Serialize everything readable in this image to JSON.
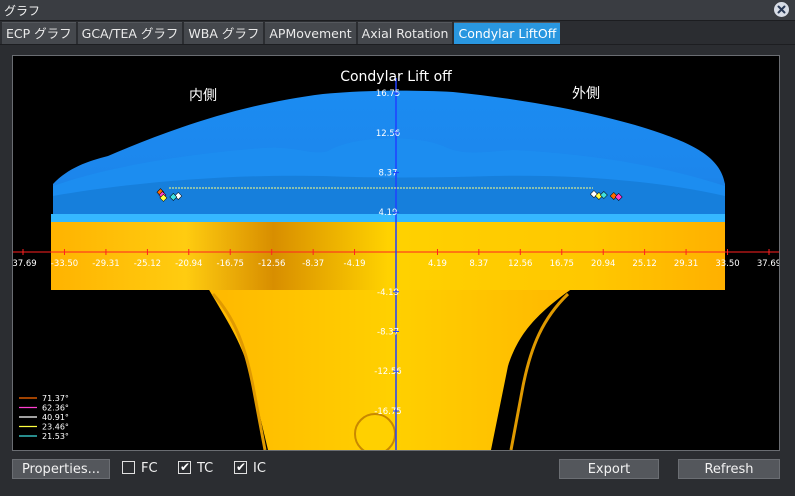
{
  "window": {
    "title": "グラフ"
  },
  "tabs": [
    {
      "label": "ECP グラフ",
      "active": false
    },
    {
      "label": "GCA/TEA グラフ",
      "active": false
    },
    {
      "label": "WBA グラフ",
      "active": false
    },
    {
      "label": "APMovement",
      "active": false
    },
    {
      "label": "Axial Rotation",
      "active": false
    },
    {
      "label": "Condylar LiftOff",
      "active": true
    }
  ],
  "chart": {
    "title": "Condylar Lift off",
    "medial_label": "内側",
    "lateral_label": "外側",
    "x_ticks": [
      "-37.69",
      "-33.50",
      "-29.31",
      "-25.12",
      "-20.94",
      "-16.75",
      "-12.56",
      "-8.37",
      "-4.19",
      "4.19",
      "8.37",
      "12.56",
      "16.75",
      "20.94",
      "25.12",
      "29.31",
      "33.50",
      "37.69"
    ],
    "y_ticks": [
      "16.75",
      "12.56",
      "8.37",
      "4.19",
      "-4.19",
      "-8.37",
      "-12.56",
      "-16.75"
    ],
    "legend": [
      {
        "label": "71.37°",
        "color": "#ff6a00"
      },
      {
        "label": "62.36°",
        "color": "#ff3fd0"
      },
      {
        "label": "40.91°",
        "color": "#ffffff"
      },
      {
        "label": "23.46°",
        "color": "#ffff40"
      },
      {
        "label": "21.53°",
        "color": "#40e0e0"
      }
    ],
    "colors": {
      "femur": "#1e90ff",
      "tibia": "#ffd000",
      "axis_h": "#ff2020",
      "axis_v": "#2040ff"
    }
  },
  "chart_data": {
    "type": "scatter",
    "title": "Condylar Lift off",
    "xlim": [
      -37.69,
      37.69
    ],
    "ylim": [
      -16.75,
      16.75
    ],
    "series": [
      {
        "name": "71.37°",
        "points": [
          [
            -23.8,
            6.3
          ],
          [
            22.0,
            5.9
          ]
        ]
      },
      {
        "name": "62.36°",
        "points": [
          [
            -23.6,
            6.0
          ],
          [
            22.5,
            5.8
          ]
        ]
      },
      {
        "name": "40.91°",
        "points": [
          [
            -22.0,
            5.9
          ],
          [
            20.0,
            6.1
          ]
        ]
      },
      {
        "name": "23.46°",
        "points": [
          [
            -23.5,
            5.7
          ],
          [
            20.5,
            5.9
          ]
        ]
      },
      {
        "name": "21.53°",
        "points": [
          [
            -22.5,
            5.8
          ],
          [
            21.0,
            6.0
          ]
        ]
      }
    ]
  },
  "controls": {
    "properties_label": "Properties...",
    "fc_label": "FC",
    "fc_checked": false,
    "tc_label": "TC",
    "tc_checked": true,
    "ic_label": "IC",
    "ic_checked": true,
    "export_label": "Export",
    "refresh_label": "Refresh"
  }
}
